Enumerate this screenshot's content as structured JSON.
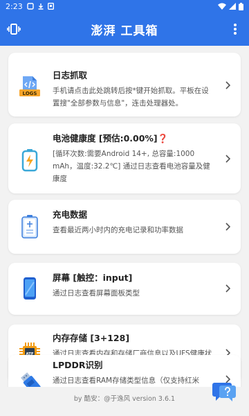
{
  "status": {
    "time": "2:23"
  },
  "appbar": {
    "title": "澎湃 工具箱"
  },
  "cards": [
    {
      "title": "日志抓取",
      "desc": "手机请点击此处跳转后按*键开始抓取。平板在设置搜\"全部参数与信息\"，连击处理器处。",
      "logs_label": "LOGS"
    },
    {
      "title": "电池健康度 [预估:0.00%]",
      "badge": "❓",
      "desc": "[循环次数:需要Android 14+, 总容量:1000 mAh，温度:32.2℃] 通过日志查看电池容量及健康度"
    },
    {
      "title": "充电数据",
      "desc": "查看最近两小时内的充电记录和功率数据"
    },
    {
      "title": "屏幕 [触控：input]",
      "desc": "通过日志查看屏幕面板类型"
    },
    {
      "title": "内存存储 [3+128]",
      "desc": "通过日志查看内存和存储厂商信息以及UFS健康状态",
      "chip_label": "ATF"
    },
    {
      "title": "LPDDR识别",
      "desc": "通过日志查看RAM存储类型信息（仅支持红米"
    }
  ],
  "footer": {
    "text": "by 酷安：@于逸风 version 3.6.1"
  },
  "colors": {
    "primary": "#2f74e8",
    "background": "#f2f2f2"
  },
  "icons": [
    "vibrate-icon",
    "more-vert-icon",
    "logs-icon",
    "battery-icon",
    "charging-icon",
    "phone-screen-icon",
    "memory-chip-icon",
    "usb-drive-icon",
    "chat-help-icon"
  ]
}
